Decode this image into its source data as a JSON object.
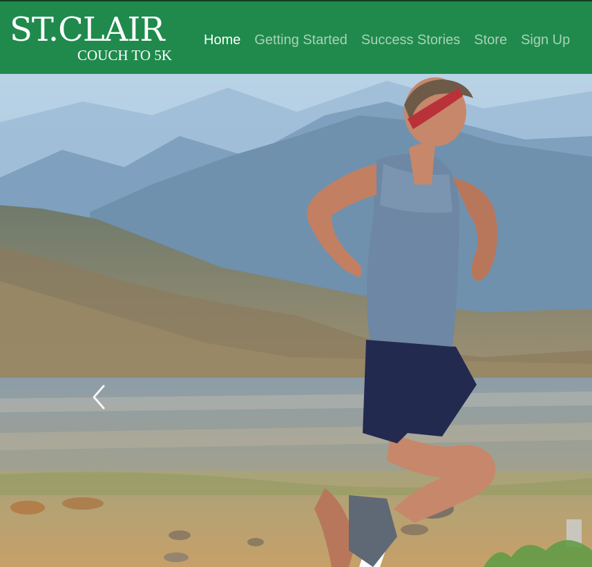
{
  "header": {
    "logo": {
      "main_text": "St.Clair",
      "sub_text": "COUCH TO 5K"
    },
    "nav": [
      {
        "label": "Home",
        "active": true
      },
      {
        "label": "Getting Started",
        "active": false
      },
      {
        "label": "Success Stories",
        "active": false
      },
      {
        "label": "Store",
        "active": false
      },
      {
        "label": "Sign Up",
        "active": false
      }
    ]
  },
  "carousel": {
    "prev_icon": "chevron-left-icon",
    "slide_image": "runner-in-mountains"
  },
  "colors": {
    "header_bg": "#1f8a4c",
    "nav_active": "#ffffff",
    "nav_inactive": "#a9d3b6"
  }
}
